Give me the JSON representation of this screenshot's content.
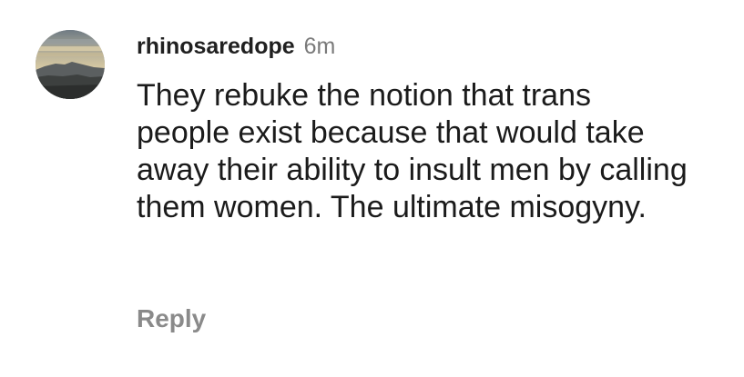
{
  "comment": {
    "username": "rhinosaredope",
    "time": "6m",
    "text": "They rebuke the notion that trans people exist because that would take away their ability to insult men by calling them women. The ultimate misogyny.",
    "reply_label": "Reply",
    "avatar_icon": "landscape-avatar-icon"
  }
}
